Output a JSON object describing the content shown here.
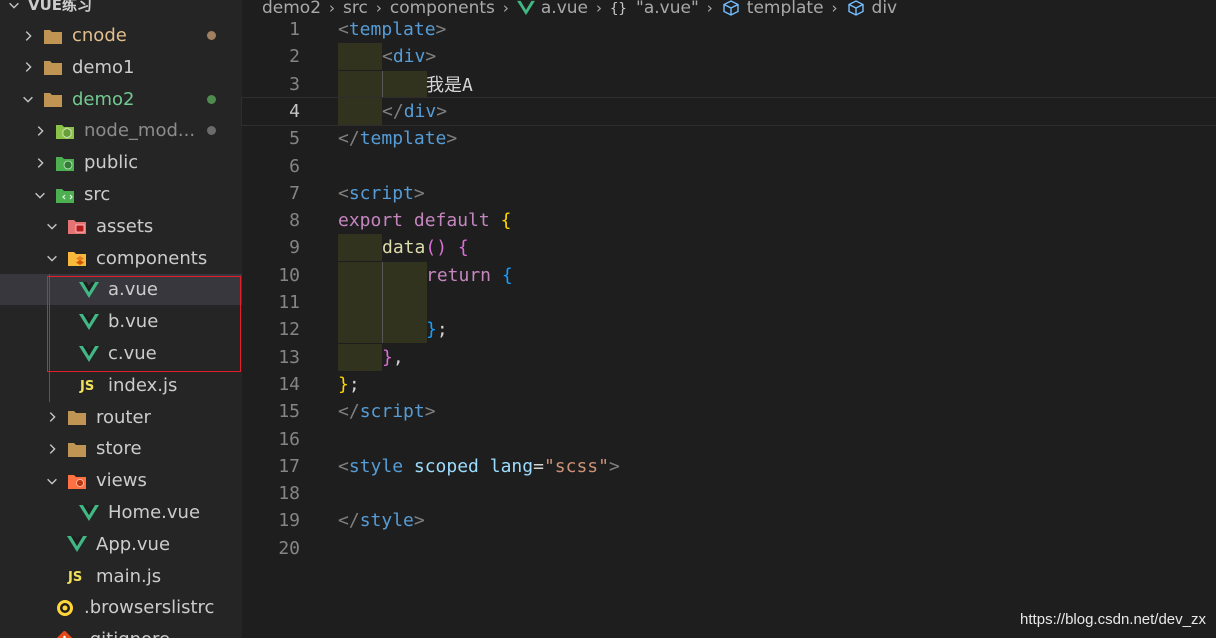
{
  "explorer": {
    "root_title": "VUE练习",
    "items": [
      {
        "label": "cnode",
        "type": "folder",
        "expanded": false,
        "depth": 0,
        "dot": "#a08060",
        "color": "#e2c08d"
      },
      {
        "label": "demo1",
        "type": "folder",
        "expanded": false,
        "depth": 0
      },
      {
        "label": "demo2",
        "type": "folder",
        "expanded": true,
        "depth": 0,
        "dot": "#4f8a4f",
        "color": "#73c991"
      },
      {
        "label": "node_mod...",
        "type": "node-folder",
        "expanded": false,
        "depth": 1,
        "dot": "#6b6b6b",
        "color": "#8c8c8c"
      },
      {
        "label": "public",
        "type": "public-folder",
        "expanded": false,
        "depth": 1
      },
      {
        "label": "src",
        "type": "src-folder",
        "expanded": true,
        "depth": 1
      },
      {
        "label": "assets",
        "type": "assets-folder",
        "expanded": true,
        "depth": 2
      },
      {
        "label": "components",
        "type": "components-folder",
        "expanded": true,
        "depth": 2
      },
      {
        "label": "a.vue",
        "type": "vue",
        "depth": 3,
        "selected": true
      },
      {
        "label": "b.vue",
        "type": "vue",
        "depth": 3
      },
      {
        "label": "c.vue",
        "type": "vue",
        "depth": 3
      },
      {
        "label": "index.js",
        "type": "js",
        "depth": 3
      },
      {
        "label": "router",
        "type": "folder",
        "expanded": false,
        "depth": 2
      },
      {
        "label": "store",
        "type": "folder",
        "expanded": false,
        "depth": 2
      },
      {
        "label": "views",
        "type": "views-folder",
        "expanded": true,
        "depth": 2
      },
      {
        "label": "Home.vue",
        "type": "vue",
        "depth": 3
      },
      {
        "label": "App.vue",
        "type": "vue",
        "depth": 2
      },
      {
        "label": "main.js",
        "type": "js",
        "depth": 2
      },
      {
        "label": ".browserslistrc",
        "type": "browserslist",
        "depth": 1
      },
      {
        "label": ".gitignore",
        "type": "git",
        "depth": 1
      }
    ]
  },
  "breadcrumb": [
    {
      "label": "demo2",
      "icon": ""
    },
    {
      "label": "src",
      "icon": ""
    },
    {
      "label": "components",
      "icon": ""
    },
    {
      "label": "a.vue",
      "icon": "vue-icon"
    },
    {
      "label": "\"a.vue\"",
      "icon": "braces-icon"
    },
    {
      "label": "template",
      "icon": "cube-icon"
    },
    {
      "label": "div",
      "icon": "cube-icon"
    }
  ],
  "editor": {
    "current_line": 4,
    "lines": [
      {
        "n": "1",
        "guides": [],
        "tokens": [
          [
            "t-br",
            "<"
          ],
          [
            "t-tag",
            "template"
          ],
          [
            "t-br",
            ">"
          ]
        ]
      },
      {
        "n": "2",
        "guides": [
          0
        ],
        "tokens": [
          [
            "t-br",
            "<"
          ],
          [
            "t-tag",
            "div"
          ],
          [
            "t-br",
            ">"
          ]
        ]
      },
      {
        "n": "3",
        "guides": [
          0,
          1
        ],
        "tokens": [
          [
            "t-txt",
            "我是A"
          ]
        ]
      },
      {
        "n": "4",
        "guides": [
          0
        ],
        "tokens": [
          [
            "t-br",
            "</"
          ],
          [
            "t-tag",
            "div"
          ],
          [
            "t-br",
            ">"
          ]
        ]
      },
      {
        "n": "5",
        "guides": [],
        "tokens": [
          [
            "t-br",
            "</"
          ],
          [
            "t-tag",
            "template"
          ],
          [
            "t-br",
            ">"
          ]
        ]
      },
      {
        "n": "6",
        "guides": [],
        "tokens": []
      },
      {
        "n": "7",
        "guides": [],
        "tokens": [
          [
            "t-br",
            "<"
          ],
          [
            "t-tag",
            "script"
          ],
          [
            "t-br",
            ">"
          ]
        ]
      },
      {
        "n": "8",
        "guides": [],
        "tokens": [
          [
            "t-kw",
            "export"
          ],
          [
            "t-pun",
            " "
          ],
          [
            "t-kw",
            "default"
          ],
          [
            "t-pun",
            " "
          ],
          [
            "b1",
            "{"
          ]
        ]
      },
      {
        "n": "9",
        "guides": [
          0
        ],
        "tokens": [
          [
            "t-fn",
            "data"
          ],
          [
            "b2",
            "()"
          ],
          [
            "t-pun",
            " "
          ],
          [
            "b2",
            "{"
          ]
        ]
      },
      {
        "n": "10",
        "guides": [
          0,
          1
        ],
        "tokens": [
          [
            "t-kw",
            "return"
          ],
          [
            "t-pun",
            " "
          ],
          [
            "b3",
            "{"
          ]
        ]
      },
      {
        "n": "11",
        "guides": [
          0,
          1
        ],
        "tokens": []
      },
      {
        "n": "12",
        "guides": [
          0,
          1
        ],
        "tokens": [
          [
            "b3",
            "}"
          ],
          [
            "t-pun",
            ";"
          ]
        ]
      },
      {
        "n": "13",
        "guides": [
          0
        ],
        "tokens": [
          [
            "b2",
            "}"
          ],
          [
            "t-pun",
            ","
          ]
        ]
      },
      {
        "n": "14",
        "guides": [],
        "tokens": [
          [
            "b1",
            "}"
          ],
          [
            "t-pun",
            ";"
          ]
        ]
      },
      {
        "n": "15",
        "guides": [],
        "tokens": [
          [
            "t-br",
            "</"
          ],
          [
            "t-tag",
            "script"
          ],
          [
            "t-br",
            ">"
          ]
        ]
      },
      {
        "n": "16",
        "guides": [],
        "tokens": []
      },
      {
        "n": "17",
        "guides": [],
        "tokens": [
          [
            "t-br",
            "<"
          ],
          [
            "t-tag",
            "style"
          ],
          [
            "t-pun",
            " "
          ],
          [
            "t-attr",
            "scoped"
          ],
          [
            "t-pun",
            " "
          ],
          [
            "t-attr",
            "lang"
          ],
          [
            "t-pun",
            "="
          ],
          [
            "t-str",
            "\"scss\""
          ],
          [
            "t-br",
            ">"
          ]
        ]
      },
      {
        "n": "18",
        "guides": [],
        "tokens": []
      },
      {
        "n": "19",
        "guides": [],
        "tokens": [
          [
            "t-br",
            "</"
          ],
          [
            "t-tag",
            "style"
          ],
          [
            "t-br",
            ">"
          ]
        ]
      },
      {
        "n": "20",
        "guides": [],
        "tokens": []
      }
    ]
  },
  "watermark": "https://blog.csdn.net/dev_zx"
}
